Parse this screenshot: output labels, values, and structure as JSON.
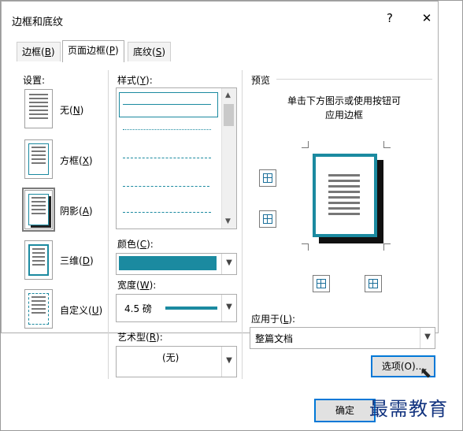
{
  "window": {
    "title": "边框和底纹",
    "help_icon": "?",
    "close_icon": "✕"
  },
  "tabs": [
    {
      "label": "边框(B)",
      "pre": "边框(",
      "key": "B",
      "post": ")"
    },
    {
      "label": "页面边框(P)",
      "pre": "页面边框(",
      "key": "P",
      "post": ")"
    },
    {
      "label": "底纹(S)",
      "pre": "底纹(",
      "key": "S",
      "post": ")"
    }
  ],
  "settings": {
    "heading_pre": "设置",
    "heading_post": ":",
    "items": [
      {
        "pre": "无(",
        "key": "N",
        "post": ")"
      },
      {
        "pre": "方框(",
        "key": "X",
        "post": ")"
      },
      {
        "pre": "阴影(",
        "key": "A",
        "post": ")"
      },
      {
        "pre": "三维(",
        "key": "D",
        "post": ")"
      },
      {
        "pre": "自定义(",
        "key": "U",
        "post": ")"
      }
    ]
  },
  "style": {
    "label_pre": "样式(",
    "label_key": "Y",
    "label_post": "):"
  },
  "color": {
    "label_pre": "颜色(",
    "label_key": "C",
    "label_post": "):",
    "value_hex": "#1b8aa0"
  },
  "width": {
    "label_pre": "宽度(",
    "label_key": "W",
    "label_post": "):",
    "value": "4.5 磅"
  },
  "art": {
    "label_pre": "艺术型(",
    "label_key": "R",
    "label_post": "):",
    "value": "(无)"
  },
  "preview": {
    "heading": "预览",
    "instruction_line1": "单击下方图示或使用按钮可",
    "instruction_line2": "应用边框"
  },
  "apply_to": {
    "label_pre": "应用于(",
    "label_key": "L",
    "label_post": "):",
    "value": "整篇文档"
  },
  "buttons": {
    "options": "选项(O)...",
    "ok": "确定"
  },
  "watermark": "最需教育",
  "colors": {
    "accent": "#1b8aa0"
  }
}
